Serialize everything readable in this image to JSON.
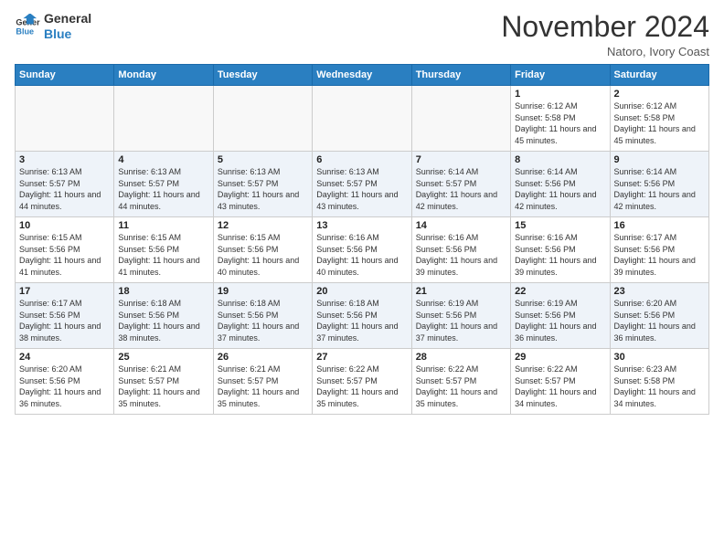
{
  "header": {
    "logo_line1": "General",
    "logo_line2": "Blue",
    "month_title": "November 2024",
    "subtitle": "Natoro, Ivory Coast"
  },
  "days_of_week": [
    "Sunday",
    "Monday",
    "Tuesday",
    "Wednesday",
    "Thursday",
    "Friday",
    "Saturday"
  ],
  "weeks": [
    [
      {
        "day": "",
        "sunrise": "",
        "sunset": "",
        "daylight": "",
        "empty": true
      },
      {
        "day": "",
        "sunrise": "",
        "sunset": "",
        "daylight": "",
        "empty": true
      },
      {
        "day": "",
        "sunrise": "",
        "sunset": "",
        "daylight": "",
        "empty": true
      },
      {
        "day": "",
        "sunrise": "",
        "sunset": "",
        "daylight": "",
        "empty": true
      },
      {
        "day": "",
        "sunrise": "",
        "sunset": "",
        "daylight": "",
        "empty": true
      },
      {
        "day": "1",
        "sunrise": "Sunrise: 6:12 AM",
        "sunset": "Sunset: 5:58 PM",
        "daylight": "Daylight: 11 hours and 45 minutes.",
        "empty": false
      },
      {
        "day": "2",
        "sunrise": "Sunrise: 6:12 AM",
        "sunset": "Sunset: 5:58 PM",
        "daylight": "Daylight: 11 hours and 45 minutes.",
        "empty": false
      }
    ],
    [
      {
        "day": "3",
        "sunrise": "Sunrise: 6:13 AM",
        "sunset": "Sunset: 5:57 PM",
        "daylight": "Daylight: 11 hours and 44 minutes.",
        "empty": false
      },
      {
        "day": "4",
        "sunrise": "Sunrise: 6:13 AM",
        "sunset": "Sunset: 5:57 PM",
        "daylight": "Daylight: 11 hours and 44 minutes.",
        "empty": false
      },
      {
        "day": "5",
        "sunrise": "Sunrise: 6:13 AM",
        "sunset": "Sunset: 5:57 PM",
        "daylight": "Daylight: 11 hours and 43 minutes.",
        "empty": false
      },
      {
        "day": "6",
        "sunrise": "Sunrise: 6:13 AM",
        "sunset": "Sunset: 5:57 PM",
        "daylight": "Daylight: 11 hours and 43 minutes.",
        "empty": false
      },
      {
        "day": "7",
        "sunrise": "Sunrise: 6:14 AM",
        "sunset": "Sunset: 5:57 PM",
        "daylight": "Daylight: 11 hours and 42 minutes.",
        "empty": false
      },
      {
        "day": "8",
        "sunrise": "Sunrise: 6:14 AM",
        "sunset": "Sunset: 5:56 PM",
        "daylight": "Daylight: 11 hours and 42 minutes.",
        "empty": false
      },
      {
        "day": "9",
        "sunrise": "Sunrise: 6:14 AM",
        "sunset": "Sunset: 5:56 PM",
        "daylight": "Daylight: 11 hours and 42 minutes.",
        "empty": false
      }
    ],
    [
      {
        "day": "10",
        "sunrise": "Sunrise: 6:15 AM",
        "sunset": "Sunset: 5:56 PM",
        "daylight": "Daylight: 11 hours and 41 minutes.",
        "empty": false
      },
      {
        "day": "11",
        "sunrise": "Sunrise: 6:15 AM",
        "sunset": "Sunset: 5:56 PM",
        "daylight": "Daylight: 11 hours and 41 minutes.",
        "empty": false
      },
      {
        "day": "12",
        "sunrise": "Sunrise: 6:15 AM",
        "sunset": "Sunset: 5:56 PM",
        "daylight": "Daylight: 11 hours and 40 minutes.",
        "empty": false
      },
      {
        "day": "13",
        "sunrise": "Sunrise: 6:16 AM",
        "sunset": "Sunset: 5:56 PM",
        "daylight": "Daylight: 11 hours and 40 minutes.",
        "empty": false
      },
      {
        "day": "14",
        "sunrise": "Sunrise: 6:16 AM",
        "sunset": "Sunset: 5:56 PM",
        "daylight": "Daylight: 11 hours and 39 minutes.",
        "empty": false
      },
      {
        "day": "15",
        "sunrise": "Sunrise: 6:16 AM",
        "sunset": "Sunset: 5:56 PM",
        "daylight": "Daylight: 11 hours and 39 minutes.",
        "empty": false
      },
      {
        "day": "16",
        "sunrise": "Sunrise: 6:17 AM",
        "sunset": "Sunset: 5:56 PM",
        "daylight": "Daylight: 11 hours and 39 minutes.",
        "empty": false
      }
    ],
    [
      {
        "day": "17",
        "sunrise": "Sunrise: 6:17 AM",
        "sunset": "Sunset: 5:56 PM",
        "daylight": "Daylight: 11 hours and 38 minutes.",
        "empty": false
      },
      {
        "day": "18",
        "sunrise": "Sunrise: 6:18 AM",
        "sunset": "Sunset: 5:56 PM",
        "daylight": "Daylight: 11 hours and 38 minutes.",
        "empty": false
      },
      {
        "day": "19",
        "sunrise": "Sunrise: 6:18 AM",
        "sunset": "Sunset: 5:56 PM",
        "daylight": "Daylight: 11 hours and 37 minutes.",
        "empty": false
      },
      {
        "day": "20",
        "sunrise": "Sunrise: 6:18 AM",
        "sunset": "Sunset: 5:56 PM",
        "daylight": "Daylight: 11 hours and 37 minutes.",
        "empty": false
      },
      {
        "day": "21",
        "sunrise": "Sunrise: 6:19 AM",
        "sunset": "Sunset: 5:56 PM",
        "daylight": "Daylight: 11 hours and 37 minutes.",
        "empty": false
      },
      {
        "day": "22",
        "sunrise": "Sunrise: 6:19 AM",
        "sunset": "Sunset: 5:56 PM",
        "daylight": "Daylight: 11 hours and 36 minutes.",
        "empty": false
      },
      {
        "day": "23",
        "sunrise": "Sunrise: 6:20 AM",
        "sunset": "Sunset: 5:56 PM",
        "daylight": "Daylight: 11 hours and 36 minutes.",
        "empty": false
      }
    ],
    [
      {
        "day": "24",
        "sunrise": "Sunrise: 6:20 AM",
        "sunset": "Sunset: 5:56 PM",
        "daylight": "Daylight: 11 hours and 36 minutes.",
        "empty": false
      },
      {
        "day": "25",
        "sunrise": "Sunrise: 6:21 AM",
        "sunset": "Sunset: 5:57 PM",
        "daylight": "Daylight: 11 hours and 35 minutes.",
        "empty": false
      },
      {
        "day": "26",
        "sunrise": "Sunrise: 6:21 AM",
        "sunset": "Sunset: 5:57 PM",
        "daylight": "Daylight: 11 hours and 35 minutes.",
        "empty": false
      },
      {
        "day": "27",
        "sunrise": "Sunrise: 6:22 AM",
        "sunset": "Sunset: 5:57 PM",
        "daylight": "Daylight: 11 hours and 35 minutes.",
        "empty": false
      },
      {
        "day": "28",
        "sunrise": "Sunrise: 6:22 AM",
        "sunset": "Sunset: 5:57 PM",
        "daylight": "Daylight: 11 hours and 35 minutes.",
        "empty": false
      },
      {
        "day": "29",
        "sunrise": "Sunrise: 6:22 AM",
        "sunset": "Sunset: 5:57 PM",
        "daylight": "Daylight: 11 hours and 34 minutes.",
        "empty": false
      },
      {
        "day": "30",
        "sunrise": "Sunrise: 6:23 AM",
        "sunset": "Sunset: 5:58 PM",
        "daylight": "Daylight: 11 hours and 34 minutes.",
        "empty": false
      }
    ]
  ]
}
